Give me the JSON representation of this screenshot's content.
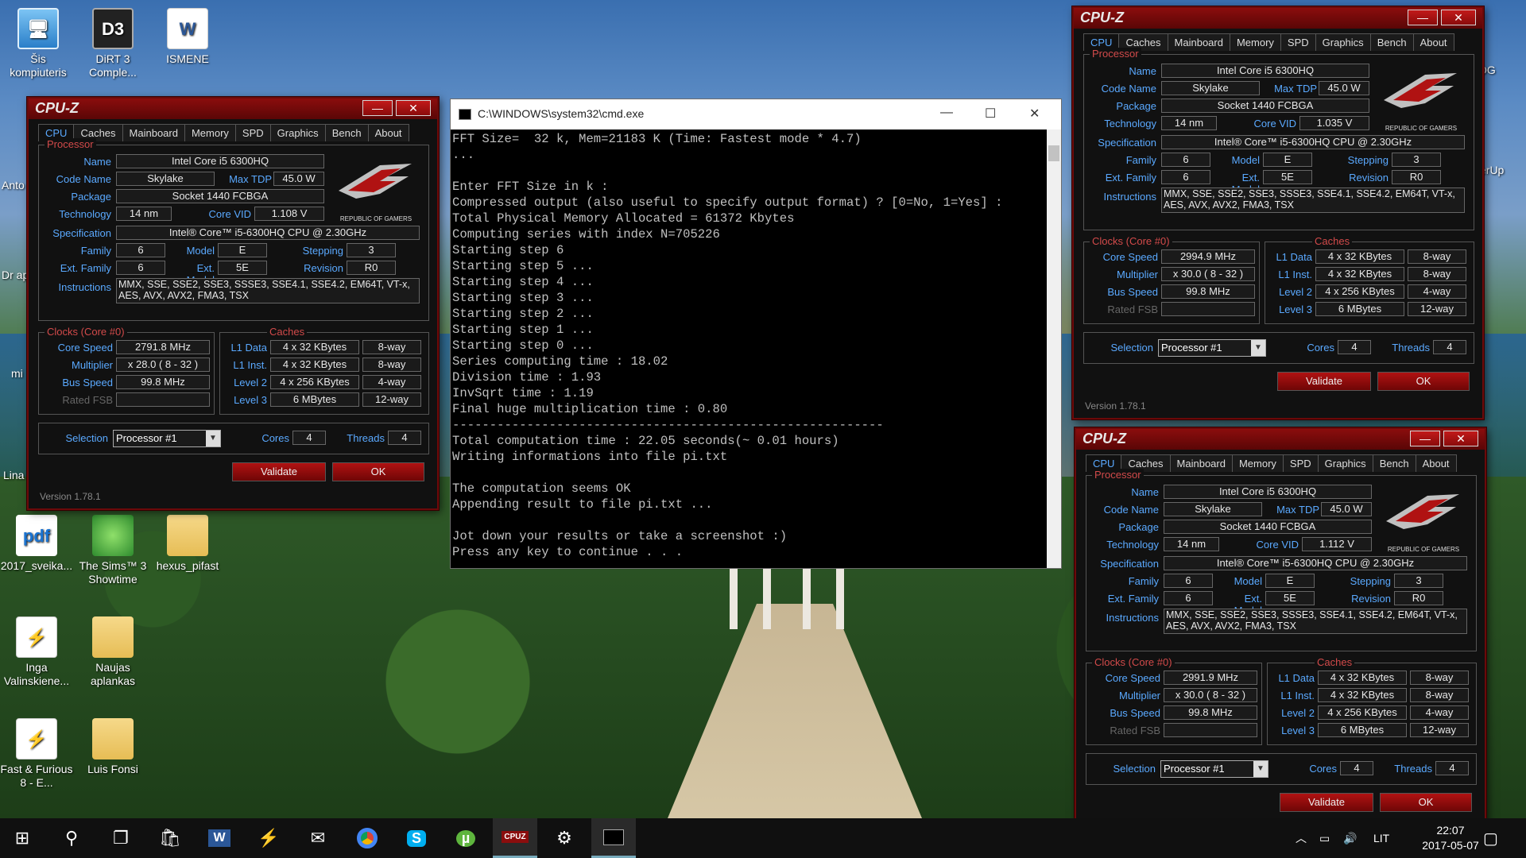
{
  "desktop": {
    "icons": [
      {
        "label": "Šis kompiuteris",
        "glyph": "🖥"
      },
      {
        "label": "DiRT 3 Comple...",
        "glyph": "D3"
      },
      {
        "label": "ISMENE",
        "glyph": "W"
      },
      {
        "label": "2017_sveika...",
        "glyph": "pdf"
      },
      {
        "label": "The Sims™ 3 Showtime",
        "glyph": ""
      },
      {
        "label": "hexus_pifast",
        "glyph": ""
      },
      {
        "label": "Inga Valinskiene...",
        "glyph": "⚡"
      },
      {
        "label": "Naujas aplankas",
        "glyph": ""
      },
      {
        "label": "Fast & Furious 8 - E...",
        "glyph": "⚡"
      },
      {
        "label": "Luis Fonsi",
        "glyph": ""
      }
    ],
    "side_labels": [
      "Anto",
      "Dr apsk",
      "mi",
      "Lina",
      "OG",
      "erUp"
    ]
  },
  "cpuz_common": {
    "title": "CPU-Z",
    "tabs": [
      "CPU",
      "Caches",
      "Mainboard",
      "Memory",
      "SPD",
      "Graphics",
      "Bench",
      "About"
    ],
    "labels": {
      "processor": "Processor",
      "name": "Name",
      "code_name": "Code Name",
      "max_tdp": "Max TDP",
      "package": "Package",
      "technology": "Technology",
      "core_vid": "Core VID",
      "specification": "Specification",
      "family": "Family",
      "model": "Model",
      "stepping": "Stepping",
      "ext_family": "Ext. Family",
      "ext_model": "Ext. Model",
      "revision": "Revision",
      "instructions": "Instructions",
      "clocks_prefix": "Clocks (Core #0)",
      "caches": "Caches",
      "core_speed": "Core Speed",
      "multiplier": "Multiplier",
      "bus_speed": "Bus Speed",
      "rated_fsb": "Rated FSB",
      "l1_data": "L1 Data",
      "l1_inst": "L1 Inst.",
      "level2": "Level 2",
      "level3": "Level 3",
      "selection": "Selection",
      "cores": "Cores",
      "threads": "Threads",
      "validate": "Validate",
      "ok": "OK",
      "version": "Version 1.78.1",
      "logo_text": "REPUBLIC OF GAMERS"
    },
    "values": {
      "name": "Intel Core i5 6300HQ",
      "code_name": "Skylake",
      "max_tdp": "45.0 W",
      "package": "Socket 1440 FCBGA",
      "technology": "14 nm",
      "specification": "Intel® Core™ i5-6300HQ CPU @ 2.30GHz",
      "family": "6",
      "model": "E",
      "stepping": "3",
      "ext_family": "6",
      "ext_model": "5E",
      "revision": "R0",
      "instructions": "MMX, SSE, SSE2, SSE3, SSSE3, SSE4.1, SSE4.2, EM64T, VT-x, AES, AVX, AVX2, FMA3, TSX",
      "bus_speed": "99.8 MHz",
      "rated_fsb": "",
      "l1_data": "4 x 32 KBytes",
      "l1_data_way": "8-way",
      "l1_inst": "4 x 32 KBytes",
      "l1_inst_way": "8-way",
      "level2": "4 x 256 KBytes",
      "level2_way": "4-way",
      "level3": "6 MBytes",
      "level3_way": "12-way",
      "selection": "Processor #1",
      "cores": "4",
      "threads": "4"
    }
  },
  "cpuz_windows": [
    {
      "core_vid": "1.108 V",
      "core_speed": "2791.8 MHz",
      "multiplier": "x 28.0 ( 8 - 32 )"
    },
    {
      "core_vid": "1.035 V",
      "core_speed": "2994.9 MHz",
      "multiplier": "x 30.0 ( 8 - 32 )"
    },
    {
      "core_vid": "1.112 V",
      "core_speed": "2991.9 MHz",
      "multiplier": "x 30.0 ( 8 - 32 )"
    }
  ],
  "cmd": {
    "title": "C:\\WINDOWS\\system32\\cmd.exe",
    "output": "FFT Size=  32 k, Mem=21183 K (Time: Fastest mode * 4.7)\n...\n\nEnter FFT Size in k :\nCompressed output (also useful to specify output format) ? [0=No, 1=Yes] :\nTotal Physical Memory Allocated = 61372 Kbytes\nComputing series with index N=705226\nStarting step 6\nStarting step 5 ...\nStarting step 4 ...\nStarting step 3 ...\nStarting step 2 ...\nStarting step 1 ...\nStarting step 0 ...\nSeries computing time : 18.02\nDivision time : 1.93\nInvSqrt time : 1.19\nFinal huge multiplication time : 0.80\n----------------------------------------------------------\nTotal computation time : 22.05 seconds(~ 0.01 hours)\nWriting informations into file pi.txt\n\nThe computation seems OK\nAppending result to file pi.txt ...\n\nJot down your results or take a screenshot :)\nPress any key to continue . . ."
  },
  "taskbar": {
    "items": [
      "start",
      "search",
      "task-view",
      "store",
      "word",
      "app",
      "mail",
      "chrome",
      "skype",
      "utorrent",
      "cpu-z",
      "settings",
      "cmd"
    ],
    "language": "LIT",
    "time": "22:07",
    "date": "2017-05-07"
  },
  "colors": {
    "cpuz_accent": "#5aa9ff",
    "cpuz_section": "#d24a4a",
    "cpuz_frame": "#8b0d0d"
  }
}
